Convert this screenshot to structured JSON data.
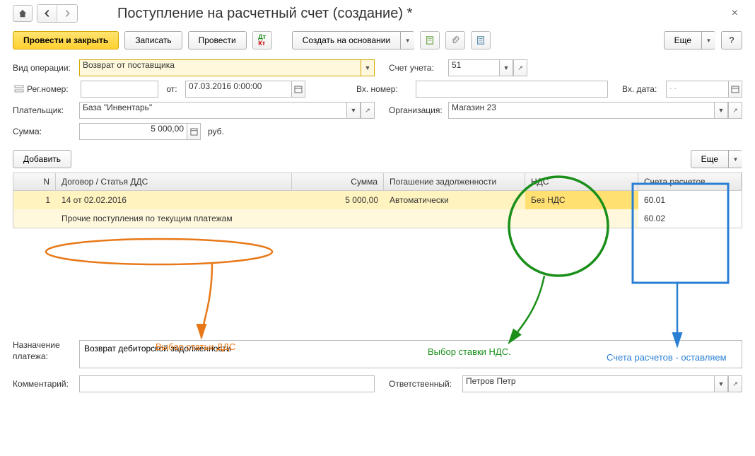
{
  "title": "Поступление на расчетный счет (создание) *",
  "toolbar": {
    "save_close": "Провести и закрыть",
    "save": "Записать",
    "post": "Провести",
    "create_based": "Создать на основании",
    "more": "Еще",
    "help": "?"
  },
  "form": {
    "operation_type_label": "Вид операции:",
    "operation_type_value": "Возврат от поставщика",
    "account_label": "Счет учета:",
    "account_value": "51",
    "reg_no_label": "Рег.номер:",
    "reg_no_value": "",
    "date_label": "от:",
    "date_value": "07.03.2016  0:00:00",
    "in_no_label": "Вх. номер:",
    "in_no_value": "",
    "in_date_label": "Вх. дата:",
    "in_date_value": ".  .",
    "payer_label": "Плательщик:",
    "payer_value": "База \"Инвентарь\"",
    "org_label": "Организация:",
    "org_value": "Магазин 23",
    "sum_label": "Сумма:",
    "sum_value": "5 000,00",
    "sum_currency": "руб.",
    "add_btn": "Добавить",
    "table_more": "Еще"
  },
  "table": {
    "headers": {
      "n": "N",
      "dogovor": "Договор / Статья ДДС",
      "summa": "Сумма",
      "pogash": "Погашение задолженности",
      "nds": "НДС",
      "scheta": "Счета расчетов"
    },
    "rows": [
      {
        "n": "1",
        "dogovor": "14 от 02.02.2016",
        "dds": "Прочие поступления по текущим платежам",
        "summa": "5 000,00",
        "pogash": "Автоматически",
        "nds": "Без НДС",
        "schet1": "60.01",
        "schet2": "60.02"
      }
    ]
  },
  "footer": {
    "purpose_label": "Назначение платежа:",
    "purpose_value": "Возврат дебиторской задолженности",
    "comment_label": "Комментарий:",
    "comment_value": "",
    "responsible_label": "Ответственный:",
    "responsible_value": "Петров Петр"
  },
  "annotations": {
    "dds": "Выбор статьи ДДС",
    "nds": "Выбор ставки НДС.",
    "scheta": "Счета расчетов - оставляем"
  }
}
